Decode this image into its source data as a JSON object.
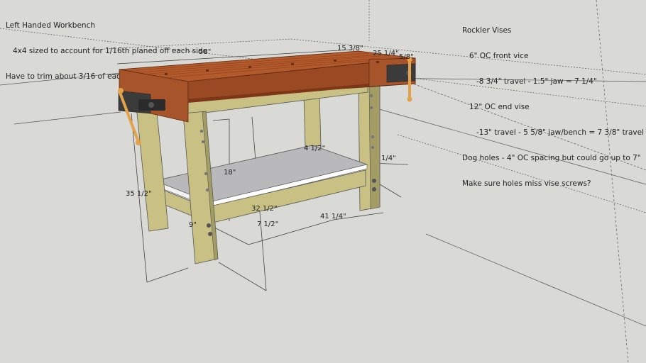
{
  "notes_left": {
    "title": "Left Handed Workbench",
    "lines": [
      "4x4 sized to account for 1/16th planed off each side",
      "Have to trim about 3/16 of each side of counter to remove bevel"
    ]
  },
  "notes_right": {
    "title": "Rockler Vises",
    "lines": [
      "6\" OC front vice",
      "-8 3/4\" travel - 1.5\" jaw = 7 1/4\"",
      "12\" OC end vise",
      "-13\" travel - 5 5/8\" jaw/bench = 7 3/8\" travel",
      "Dog holes - 4\" OC spacing but could go up to 7\"",
      "Make sure holes miss vise screws?"
    ]
  },
  "dimensions": {
    "top_length": "58\"",
    "top_depth_a": "15 3/8\"",
    "top_depth_b": "25 1/4\"",
    "top_depth_c": "5/8\"",
    "shelf_height": "18\"",
    "bench_height": "35 1/2\"",
    "shelf_width": "32 1/2\"",
    "rail_height": "7 1/2\"",
    "base_length": "41 1/4\"",
    "side_offset": "1/4\"",
    "leg_size": "9\"",
    "rear_note": "4 1/2\""
  },
  "colors": {
    "background": "#d9d9d6",
    "wood_top": "#a8542a",
    "wood_top_dark": "#7d3718",
    "wood_legs": "#c9c184",
    "wood_legs_dark": "#a39c64",
    "shelf": "#b9b9bb",
    "vise_metal": "#3b3b3b",
    "vise_handle": "#e2a34a"
  }
}
